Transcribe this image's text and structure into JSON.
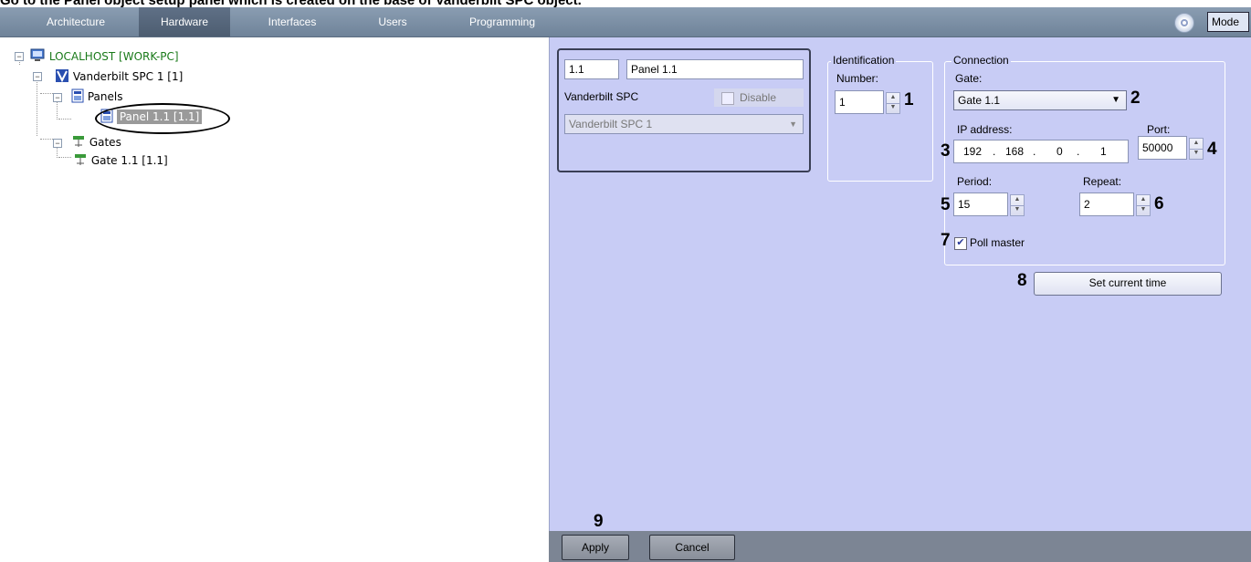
{
  "caption": "Go to the Panel object setup panel which is created on the base of Vanderbilt SPC object.",
  "topbar": {
    "tabs": [
      {
        "label": "Architecture",
        "active": false
      },
      {
        "label": "Hardware",
        "active": true
      },
      {
        "label": "Interfaces",
        "active": false
      },
      {
        "label": "Users",
        "active": false
      },
      {
        "label": "Programming",
        "active": false
      }
    ],
    "mode_label": "Mode"
  },
  "tree": {
    "root": "LOCALHOST [WORK-PC]",
    "device": "Vanderbilt SPC 1 [1]",
    "panels_group": "Panels",
    "panel_item": "Panel 1.1 [1.1]",
    "gates_group": "Gates",
    "gate_item": "Gate 1.1 [1.1]",
    "pm_minus": "−"
  },
  "object": {
    "id": "1.1",
    "name": "Panel 1.1",
    "type_label": "Vanderbilt SPC",
    "disable_label": "Disable",
    "parent_select": "Vanderbilt SPC 1"
  },
  "identification": {
    "group_label": "Identification",
    "number_label": "Number:",
    "number_value": "1"
  },
  "connection": {
    "group_label": "Connection",
    "gate_label": "Gate:",
    "gate_value": "Gate 1.1",
    "ip_label": "IP address:",
    "ip": [
      "192",
      "168",
      "0",
      "1"
    ],
    "ip_sep": ".",
    "port_label": "Port:",
    "port_value": "50000",
    "period_label": "Period:",
    "period_value": "15",
    "repeat_label": "Repeat:",
    "repeat_value": "2",
    "poll_master_label": "Poll master",
    "poll_master_checked": true,
    "set_time_label": "Set current time"
  },
  "callouts": [
    "1",
    "2",
    "3",
    "4",
    "5",
    "6",
    "7",
    "8",
    "9"
  ],
  "footer": {
    "apply_label": "Apply",
    "cancel_label": "Cancel"
  },
  "colors": {
    "panel_bg": "#c8ccf5",
    "topbar": "#7b8ea4",
    "highlight": "#9a9a9a",
    "tree_root_text": "#1a7a1a"
  }
}
